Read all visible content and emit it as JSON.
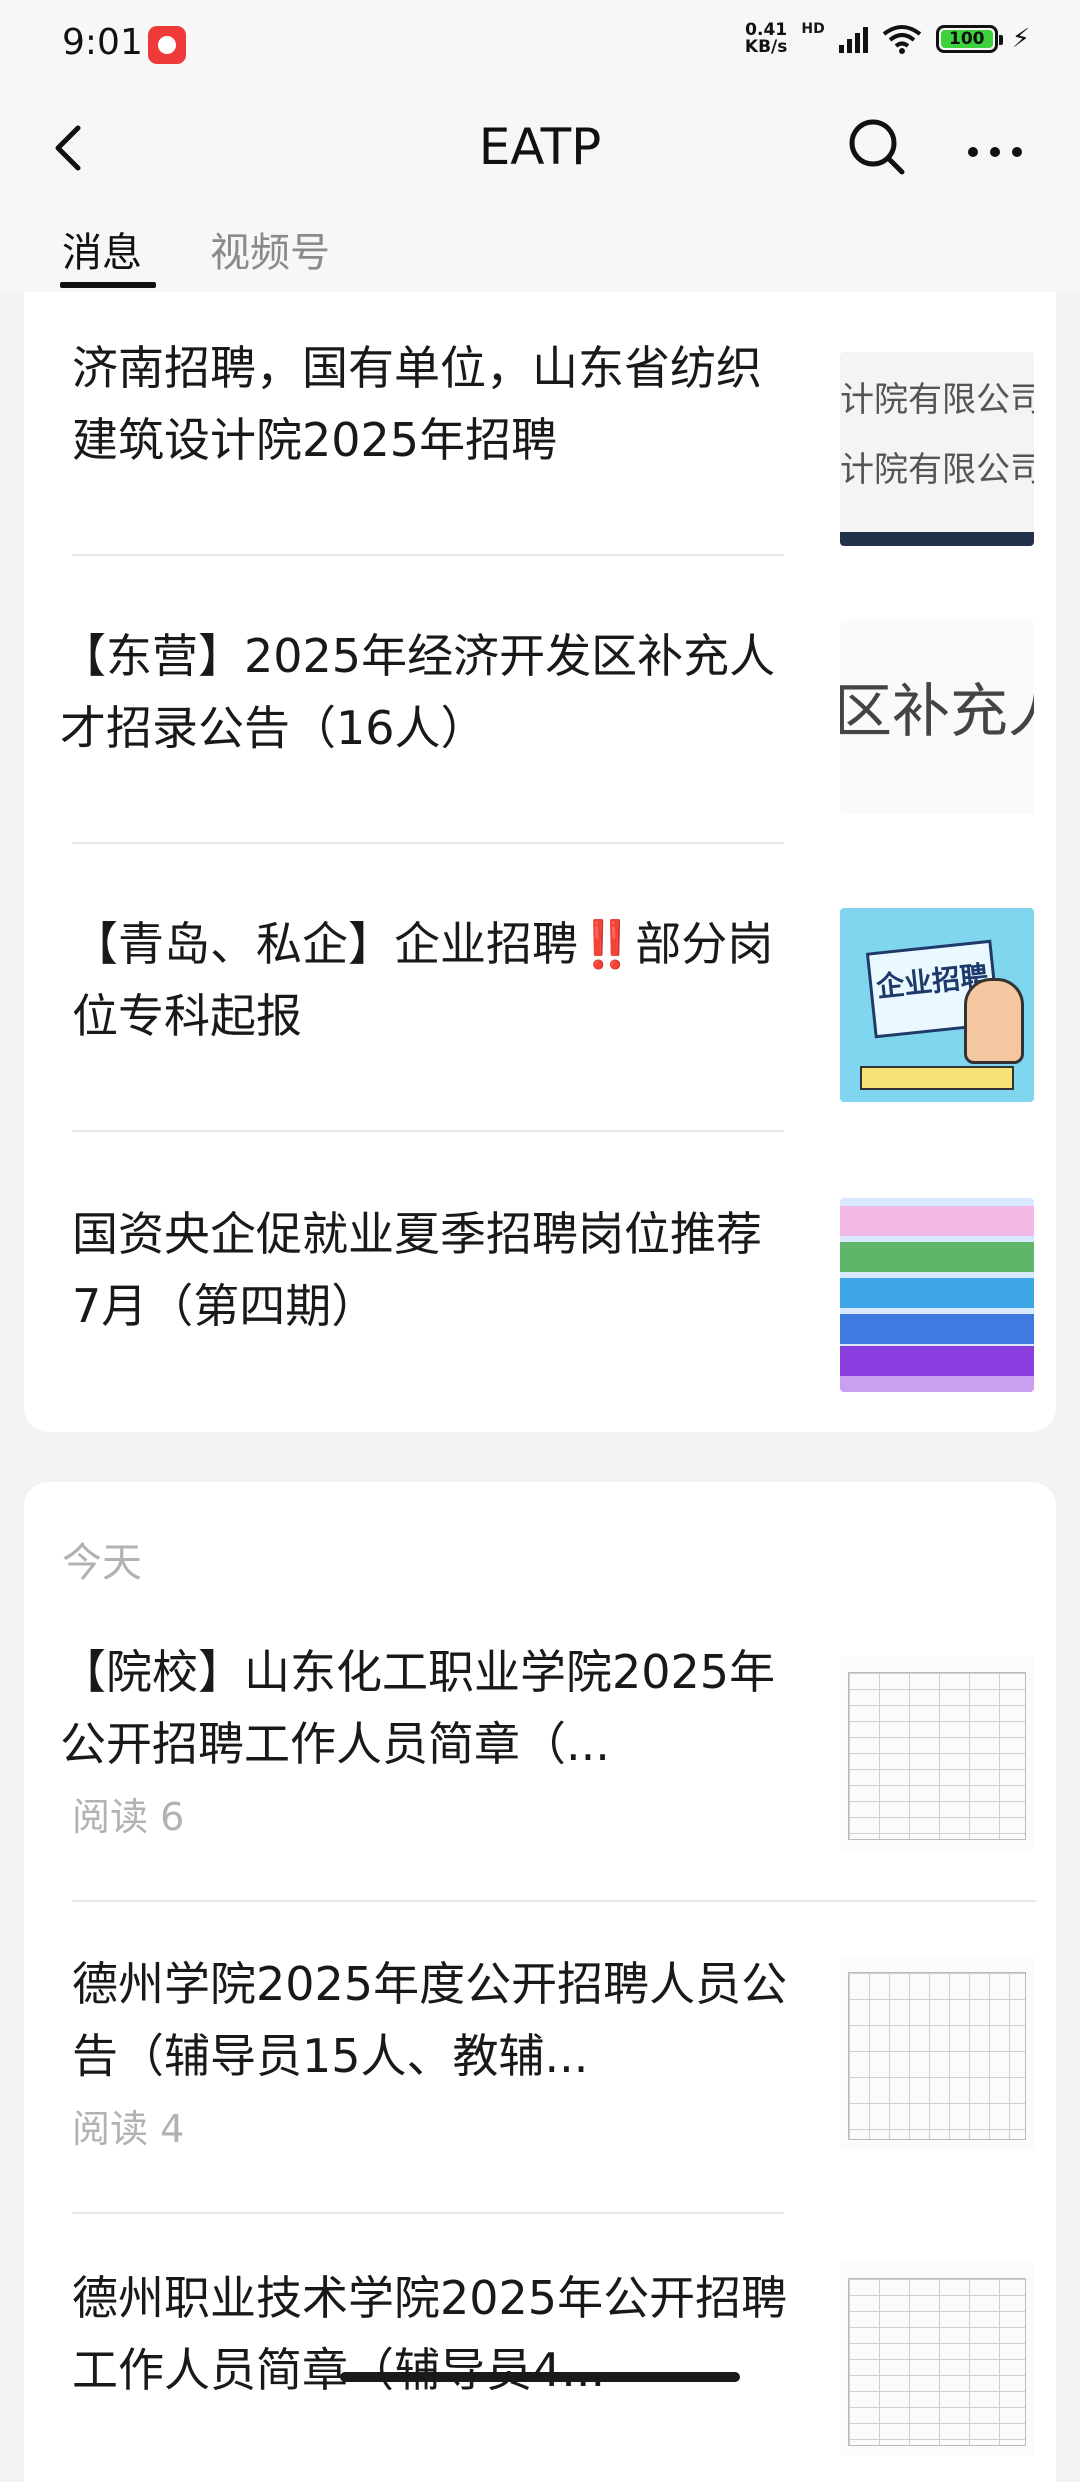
{
  "status_bar": {
    "time": "9:01",
    "net_speed_value": "0.41",
    "net_speed_unit": "KB/s",
    "hd_label": "HD",
    "battery_level": "100"
  },
  "header": {
    "title": "EATP"
  },
  "tabs": [
    {
      "label": "消息",
      "active": true
    },
    {
      "label": "视频号",
      "active": false
    }
  ],
  "feed": {
    "group1_items": [
      {
        "title": "济南招聘，国有单位，山东省纺织建筑设计院2025年招聘",
        "thumbnail_text": "计院有限公司"
      },
      {
        "title": "【东营】2025年经济开发区补充人才招录公告（16人）",
        "thumbnail_text": "区补充人"
      },
      {
        "title": "【青岛、私企】企业招聘‼️部分岗位专科起报",
        "thumbnail_text": "企业招聘"
      },
      {
        "title": "国资央企促就业夏季招聘岗位推荐 7月（第四期）"
      }
    ],
    "group2": {
      "section_label": "今天",
      "items": [
        {
          "title": "【院校】山东化工职业学院2025年公开招聘工作人员简章（...",
          "reads": "阅读 6"
        },
        {
          "title": "德州学院2025年度公开招聘人员公告（辅导员15人、教辅...",
          "reads": "阅读 4"
        },
        {
          "title": "德州职业技术学院2025年公开招聘工作人员简章（辅导员4..."
        }
      ]
    }
  },
  "colors": {
    "background": "#f2f2f2",
    "card": "#ffffff",
    "secondary_text": "#b2b2b2",
    "battery_fill": "#3ed13e"
  }
}
